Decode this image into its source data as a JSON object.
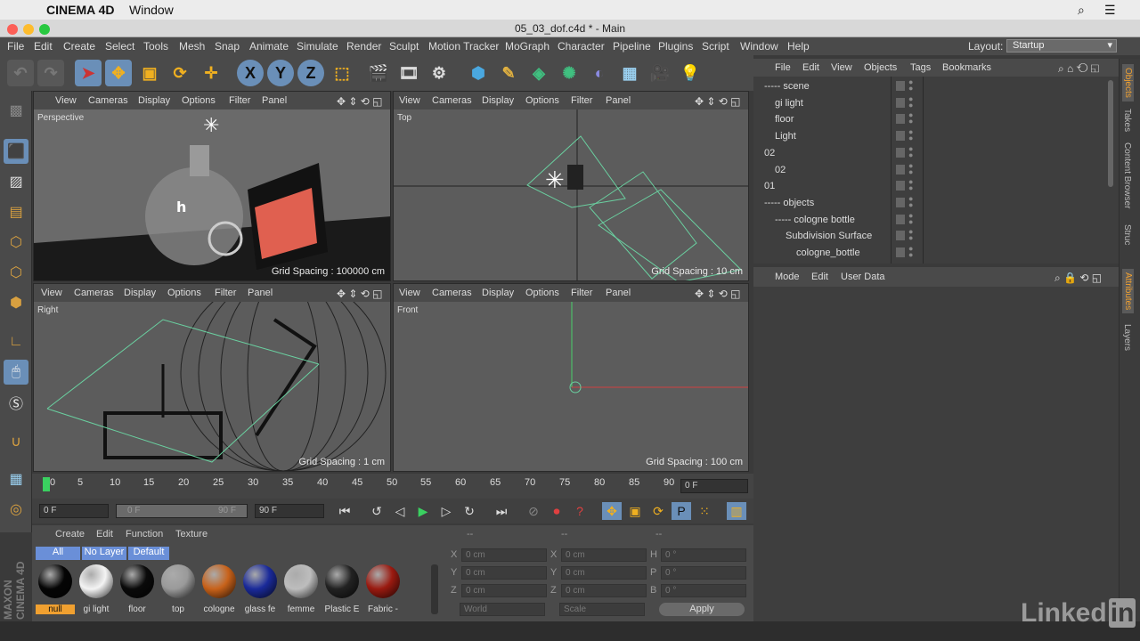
{
  "mac": {
    "app_name": "CINEMA 4D",
    "menu_window": "Window"
  },
  "title": "05_03_dof.c4d * - Main",
  "menubar": {
    "items": [
      "File",
      "Edit",
      "Create",
      "Select",
      "Tools",
      "Mesh",
      "Snap",
      "Animate",
      "Simulate",
      "Render",
      "Sculpt",
      "Motion Tracker",
      "MoGraph",
      "Character",
      "Pipeline",
      "Plugins",
      "Script",
      "Window",
      "Help"
    ],
    "layout_label": "Layout:",
    "layout_value": "Startup"
  },
  "viewport_menu": [
    "View",
    "Cameras",
    "Display",
    "Options",
    "Filter",
    "Panel"
  ],
  "viewports": [
    {
      "label": "Perspective",
      "grid": "Grid Spacing : 100000 cm"
    },
    {
      "label": "Top",
      "grid": "Grid Spacing : 10 cm"
    },
    {
      "label": "Right",
      "grid": "Grid Spacing : 1 cm"
    },
    {
      "label": "Front",
      "grid": "Grid Spacing : 100 cm"
    }
  ],
  "timeline": {
    "ticks": [
      "0",
      "5",
      "10",
      "15",
      "20",
      "25",
      "30",
      "35",
      "40",
      "45",
      "50",
      "55",
      "60",
      "65",
      "70",
      "75",
      "80",
      "85",
      "90"
    ],
    "current": "0 F"
  },
  "transport": {
    "start": "0 F",
    "range_start": "0 F",
    "range_end": "90 F",
    "end": "90 F"
  },
  "materials": {
    "menu": [
      "Create",
      "Edit",
      "Function",
      "Texture"
    ],
    "filters": [
      "All",
      "No Layer",
      "Default"
    ],
    "items": [
      {
        "name": "null",
        "color": "#050505"
      },
      {
        "name": "gi light",
        "color": "#f4f4f4"
      },
      {
        "name": "floor",
        "color": "#0a0a0a"
      },
      {
        "name": "top",
        "color": "#9a9a9a"
      },
      {
        "name": "cologne",
        "color": "#c8621a"
      },
      {
        "name": "glass fe",
        "color": "#1a2a9a"
      },
      {
        "name": "femme",
        "color": "#bdbdbd"
      },
      {
        "name": "Plastic E",
        "color": "#222222"
      },
      {
        "name": "Fabric -",
        "color": "#9a1a10"
      }
    ]
  },
  "coords": {
    "headers": [
      "--",
      "--",
      "--"
    ],
    "rows": [
      {
        "l1": "X",
        "v1": "0 cm",
        "l2": "X",
        "v2": "0 cm",
        "l3": "H",
        "v3": "0 °"
      },
      {
        "l1": "Y",
        "v1": "0 cm",
        "l2": "Y",
        "v2": "0 cm",
        "l3": "P",
        "v3": "0 °"
      },
      {
        "l1": "Z",
        "v1": "0 cm",
        "l2": "Z",
        "v2": "0 cm",
        "l3": "B",
        "v3": "0 °"
      }
    ],
    "world": "World",
    "scale": "Scale",
    "apply": "Apply"
  },
  "objects": {
    "menu": [
      "File",
      "Edit",
      "View",
      "Objects",
      "Tags",
      "Bookmarks"
    ],
    "rows": [
      {
        "name": "----- scene",
        "indent": 0
      },
      {
        "name": "gi light",
        "indent": 1
      },
      {
        "name": "floor",
        "indent": 1
      },
      {
        "name": "Light",
        "indent": 1
      },
      {
        "name": "02",
        "indent": 0
      },
      {
        "name": "02",
        "indent": 1
      },
      {
        "name": "01",
        "indent": 0
      },
      {
        "name": "----- objects",
        "indent": 0
      },
      {
        "name": "----- cologne bottle",
        "indent": 1
      },
      {
        "name": "Subdivision Surface",
        "indent": 2
      },
      {
        "name": "cologne_bottle",
        "indent": 3
      }
    ]
  },
  "attributes": {
    "menu": [
      "Mode",
      "Edit",
      "User Data"
    ]
  },
  "side_tabs": [
    "Objects",
    "Takes",
    "Content Browser",
    "Struc",
    "Attributes",
    "Layers"
  ],
  "brand": {
    "maxon": "MAXON",
    "c4d": "CINEMA 4D",
    "linkedin": "Linked",
    "in": "in"
  }
}
